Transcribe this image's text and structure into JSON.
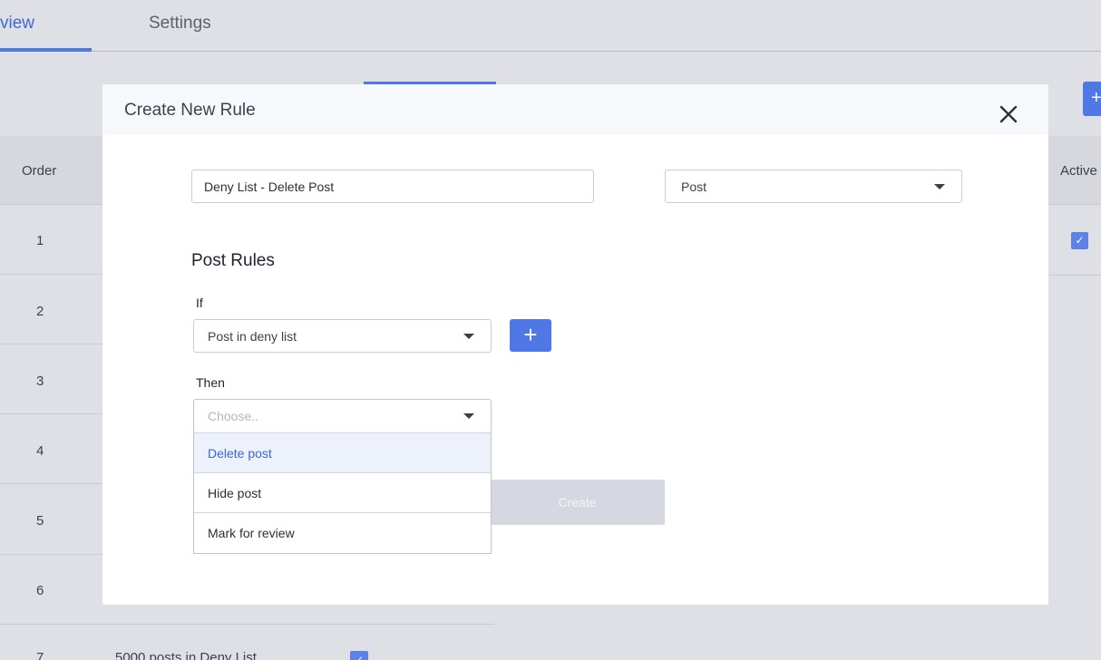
{
  "tabs": {
    "active_label": "view",
    "settings_label": "Settings"
  },
  "table": {
    "header_order": "Order",
    "header_active": "Active",
    "rows": [
      {
        "order": "1"
      },
      {
        "order": "2"
      },
      {
        "order": "3"
      },
      {
        "order": "4"
      },
      {
        "order": "5"
      },
      {
        "order": "6"
      },
      {
        "order": "7",
        "name": "5000 posts in Deny List"
      }
    ],
    "add_label": "+"
  },
  "modal": {
    "title": "Create New Rule",
    "close_icon": "close-icon",
    "rule_name_value": "Deny List - Delete Post",
    "type_value": "Post",
    "section_title": "Post Rules",
    "if_label": "If",
    "if_value": "Post in deny list",
    "add_condition_label": "+",
    "then_label": "Then",
    "then_placeholder": "Choose..",
    "then_options": [
      "Delete post",
      "Hide post",
      "Mark for review"
    ],
    "selected_option": "Delete post",
    "create_label": "Create"
  },
  "colors": {
    "accent": "#4f78e4",
    "selected_text": "#3e67d8",
    "selected_bg": "#edf1fb",
    "disabled_button": "#d5d8e1"
  }
}
